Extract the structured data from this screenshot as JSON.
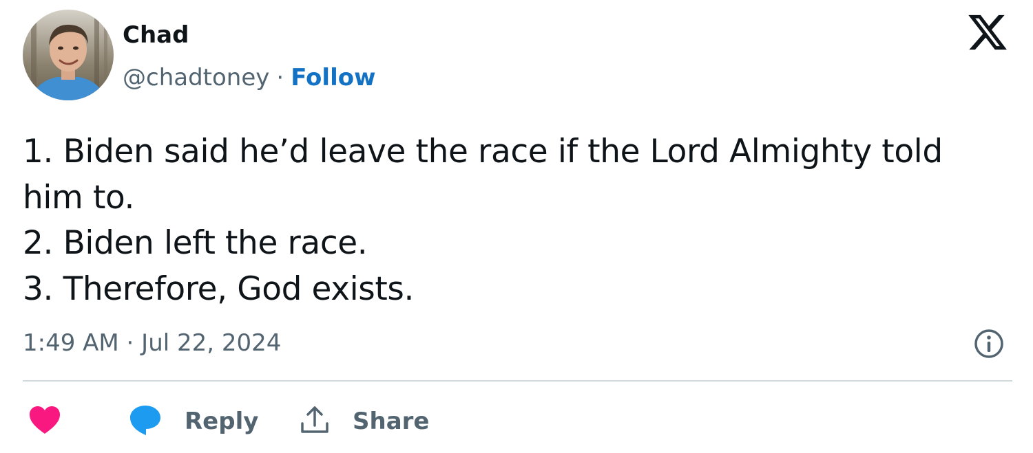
{
  "author": {
    "display_name": "Chad",
    "handle": "@chadtoney",
    "separator": "·",
    "follow_label": "Follow",
    "avatar_icon": "profile-photo"
  },
  "platform": {
    "logo_icon": "x-logo"
  },
  "tweet": {
    "lines": [
      "1. Biden said he’d leave the race if the Lord Almighty told",
      "him to.",
      "2. Biden left the race.",
      "3. Therefore, God exists."
    ],
    "timestamp": "1:49 AM · Jul 22, 2024"
  },
  "actions": {
    "like_icon": "heart-icon",
    "reply_icon": "speech-bubble-icon",
    "reply_label": "Reply",
    "share_icon": "share-upload-icon",
    "share_label": "Share",
    "info_icon": "info-icon"
  },
  "colors": {
    "text": "#0f1419",
    "secondary": "#536471",
    "follow_link": "#1472c4",
    "like": "#f91880",
    "reply": "#1d9bf0",
    "divider": "#cfd9de"
  }
}
